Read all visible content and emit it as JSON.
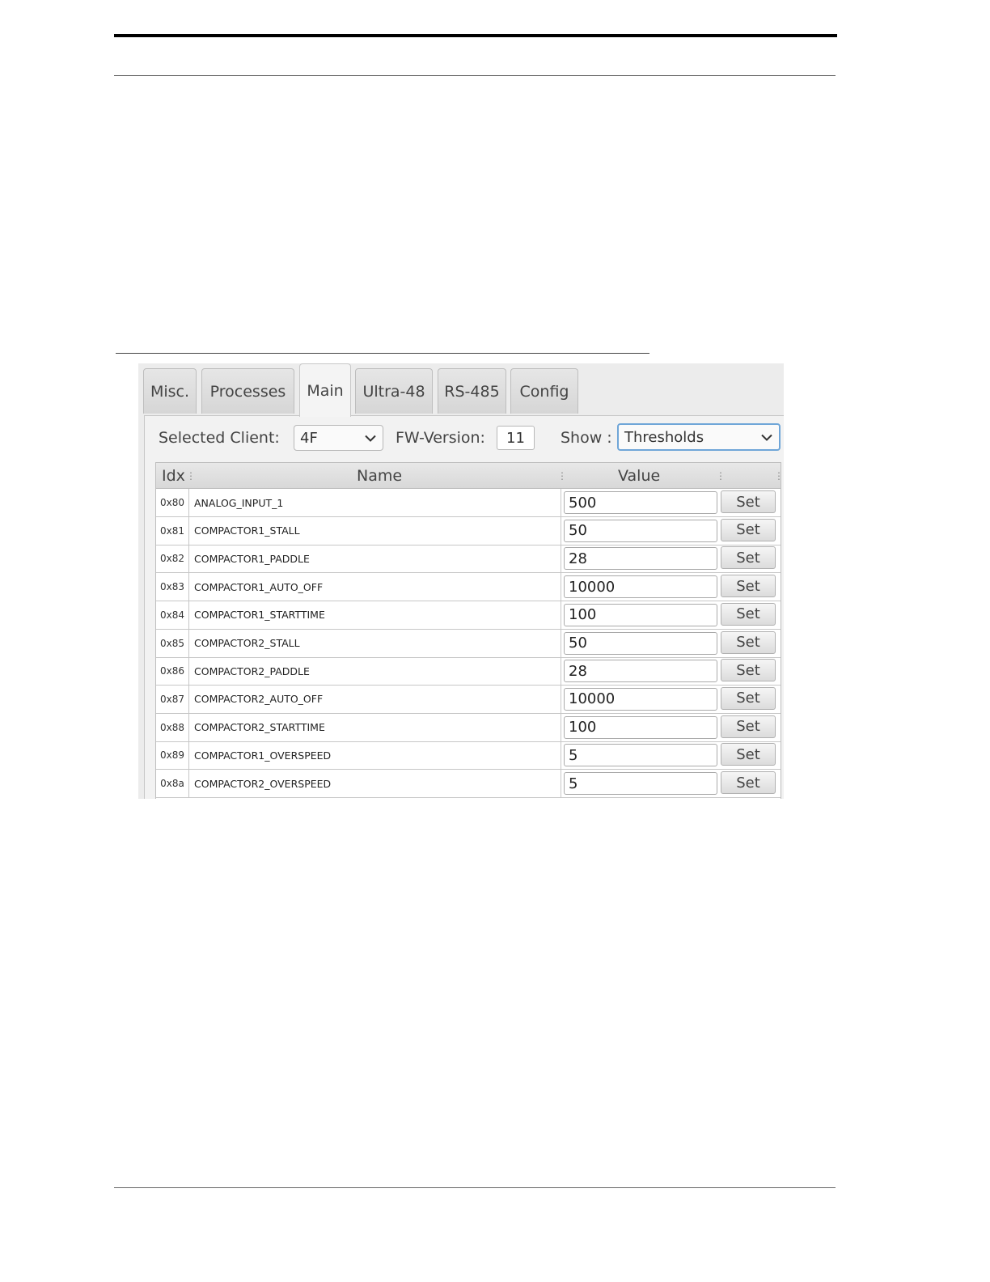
{
  "tabs": [
    {
      "label": "Misc."
    },
    {
      "label": "Processes"
    },
    {
      "label": "Main"
    },
    {
      "label": "Ultra-48"
    },
    {
      "label": "RS-485"
    },
    {
      "label": "Config"
    }
  ],
  "active_tab": "Main",
  "toolbar": {
    "client_label": "Selected Client:",
    "client_value": "4F",
    "fw_label": "FW-Version:",
    "fw_value": "11",
    "show_label": "Show :",
    "show_value": "Thresholds"
  },
  "table": {
    "headers": [
      "Idx",
      "Name",
      "Value"
    ],
    "set_label": "Set",
    "rows": [
      {
        "idx": "0x80",
        "name": "ANALOG_INPUT_1",
        "value": "500"
      },
      {
        "idx": "0x81",
        "name": "COMPACTOR1_STALL",
        "value": "50"
      },
      {
        "idx": "0x82",
        "name": "COMPACTOR1_PADDLE",
        "value": "28"
      },
      {
        "idx": "0x83",
        "name": "COMPACTOR1_AUTO_OFF",
        "value": "10000"
      },
      {
        "idx": "0x84",
        "name": "COMPACTOR1_STARTTIME",
        "value": "100"
      },
      {
        "idx": "0x85",
        "name": "COMPACTOR2_STALL",
        "value": "50"
      },
      {
        "idx": "0x86",
        "name": "COMPACTOR2_PADDLE",
        "value": "28"
      },
      {
        "idx": "0x87",
        "name": "COMPACTOR2_AUTO_OFF",
        "value": "10000"
      },
      {
        "idx": "0x88",
        "name": "COMPACTOR2_STARTTIME",
        "value": "100"
      },
      {
        "idx": "0x89",
        "name": "COMPACTOR1_OVERSPEED",
        "value": "5"
      },
      {
        "idx": "0x8a",
        "name": "COMPACTOR2_OVERSPEED",
        "value": "5"
      }
    ]
  },
  "icons": {
    "dropdown": "chevron-down-icon",
    "column_grip": "column-resize-icon"
  }
}
